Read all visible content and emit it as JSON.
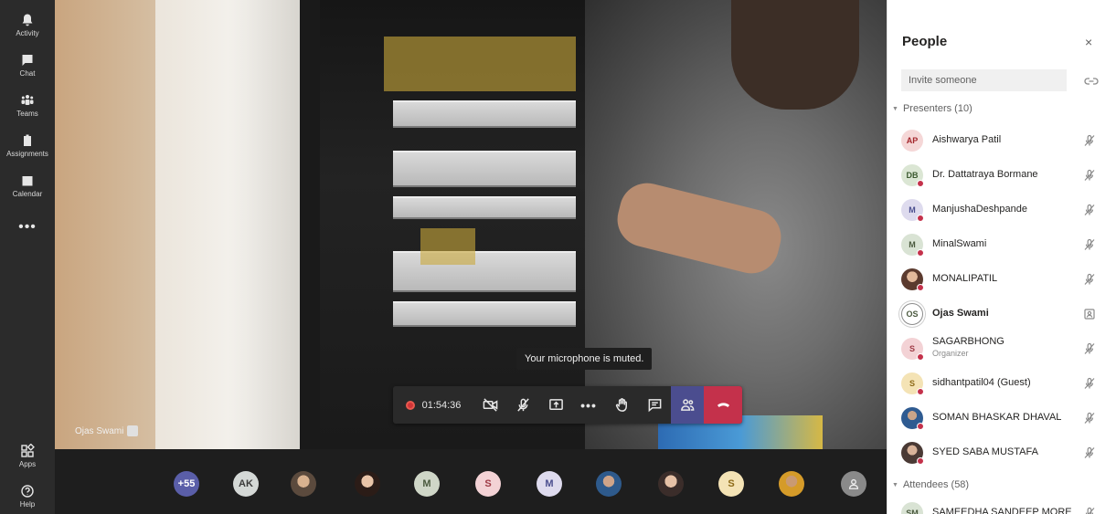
{
  "rail": {
    "items": [
      {
        "label": "Activity",
        "icon": "bell-icon"
      },
      {
        "label": "Chat",
        "icon": "chat-icon"
      },
      {
        "label": "Teams",
        "icon": "teams-icon"
      },
      {
        "label": "Assignments",
        "icon": "assignments-icon"
      },
      {
        "label": "Calendar",
        "icon": "calendar-icon"
      }
    ],
    "more": "•••",
    "bottom": [
      {
        "label": "Apps",
        "icon": "apps-icon"
      },
      {
        "label": "Help",
        "icon": "help-icon"
      }
    ]
  },
  "video": {
    "name_tag": "Ojas Swami",
    "toast": "Your microphone is muted."
  },
  "controls": {
    "timer": "01:54:36",
    "more": "•••"
  },
  "strip": {
    "overflow": "+55",
    "initials": {
      "ak": "AK",
      "m": "M",
      "s": "S",
      "m2": "M",
      "s2": "S"
    }
  },
  "panel": {
    "title": "People",
    "close": "×",
    "invite_placeholder": "Invite someone",
    "presenters_label": "Presenters (10)",
    "attendees_label": "Attendees (58)",
    "presenters": [
      {
        "initials": "AP",
        "name": "Aishwarya Patil"
      },
      {
        "initials": "DB",
        "name": "Dr. Dattatraya Bormane"
      },
      {
        "initials": "M",
        "name": "ManjushaDeshpande"
      },
      {
        "initials": "M",
        "name": "MinalSwami"
      },
      {
        "initials": "",
        "name": "MONALIPATIL"
      },
      {
        "initials": "OS",
        "name": "Ojas Swami"
      },
      {
        "initials": "S",
        "name": "SAGARBHONG",
        "role": "Organizer"
      },
      {
        "initials": "S",
        "name": "sidhantpatil04 (Guest)"
      },
      {
        "initials": "",
        "name": "SOMAN BHASKAR DHAVAL"
      },
      {
        "initials": "",
        "name": "SYED SABA MUSTAFA"
      }
    ],
    "attendees": [
      {
        "initials": "SM",
        "name": "SAMEEDHA SANDEEP MORE"
      }
    ]
  },
  "colors": {
    "accent": "#4b4d8f",
    "hangup": "#c4314b",
    "presence_busy": "#c4314b"
  }
}
